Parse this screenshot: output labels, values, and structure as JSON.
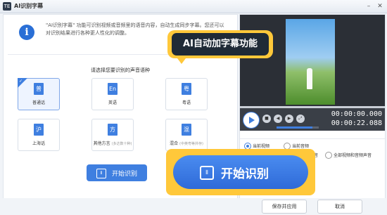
{
  "window": {
    "title": "AI识别字幕",
    "app_icon": "TE"
  },
  "info": {
    "icon": "i",
    "text": "\"AI识别字幕\" 功能可识别视频或音频里的语音内容，自动生成同步字幕。您还可以对识别结果进行各种更人性化的调整。"
  },
  "prompt": "请选择您要识别的声音语种",
  "languages": [
    {
      "glyph": "普",
      "label": "普通话",
      "note": "",
      "selected": true
    },
    {
      "glyph": "En",
      "label": "英语",
      "note": "",
      "selected": false
    },
    {
      "glyph": "粤",
      "label": "粤语",
      "note": "",
      "selected": false
    },
    {
      "glyph": "沪",
      "label": "上海话",
      "note": "",
      "selected": false
    },
    {
      "glyph": "方",
      "label": "其他方言",
      "note": "(多达数十种)",
      "selected": false
    },
    {
      "glyph": "混",
      "label": "混合",
      "note": "(中英粤等并存)",
      "selected": false
    }
  ],
  "start_button": {
    "label": "开始识别",
    "icon": "waveform-icon"
  },
  "callout": {
    "text": "AI自动加字幕功能"
  },
  "zoom_button": {
    "label": "开始识别",
    "icon": "waveform-icon"
  },
  "player": {
    "time_current": "00:00:00.000",
    "time_total": "00:00:22.088",
    "volume": 0.85
  },
  "apply_options": [
    {
      "label": "当前视频",
      "on": true
    },
    {
      "label": "当前音频",
      "on": false
    },
    {
      "label": "音",
      "on": false
    },
    {
      "label": "全部视频和音频声音",
      "on": false
    }
  ],
  "footer": {
    "save": "保存并应用",
    "cancel": "取消"
  }
}
